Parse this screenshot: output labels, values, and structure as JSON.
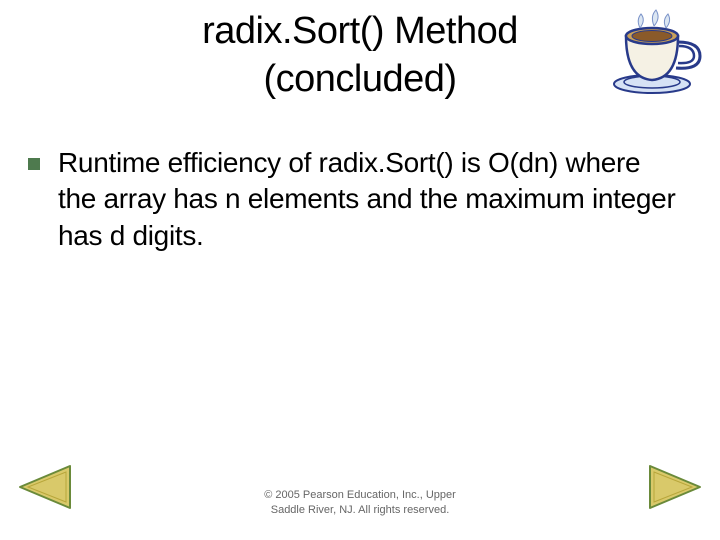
{
  "title": {
    "line1": "radix.Sort() Method",
    "line2": "(concluded)"
  },
  "bullet": {
    "text": "Runtime efficiency of radix.Sort() is O(dn) where the array has n elements and the maximum integer has d digits."
  },
  "copyright": {
    "line1": "© 2005 Pearson Education, Inc., Upper",
    "line2": "Saddle River, NJ. All rights reserved."
  },
  "icons": {
    "coffee": "coffee-cup",
    "prev": "previous-arrow",
    "next": "next-arrow"
  },
  "colors": {
    "bullet_square": "#4e7a4e",
    "arrow_fill": "#d9c96a",
    "arrow_stroke": "#6a8a3a",
    "cup_fill": "#f5f1e4",
    "cup_stroke": "#283a8a",
    "saucer_fill": "#d6e2f5"
  }
}
